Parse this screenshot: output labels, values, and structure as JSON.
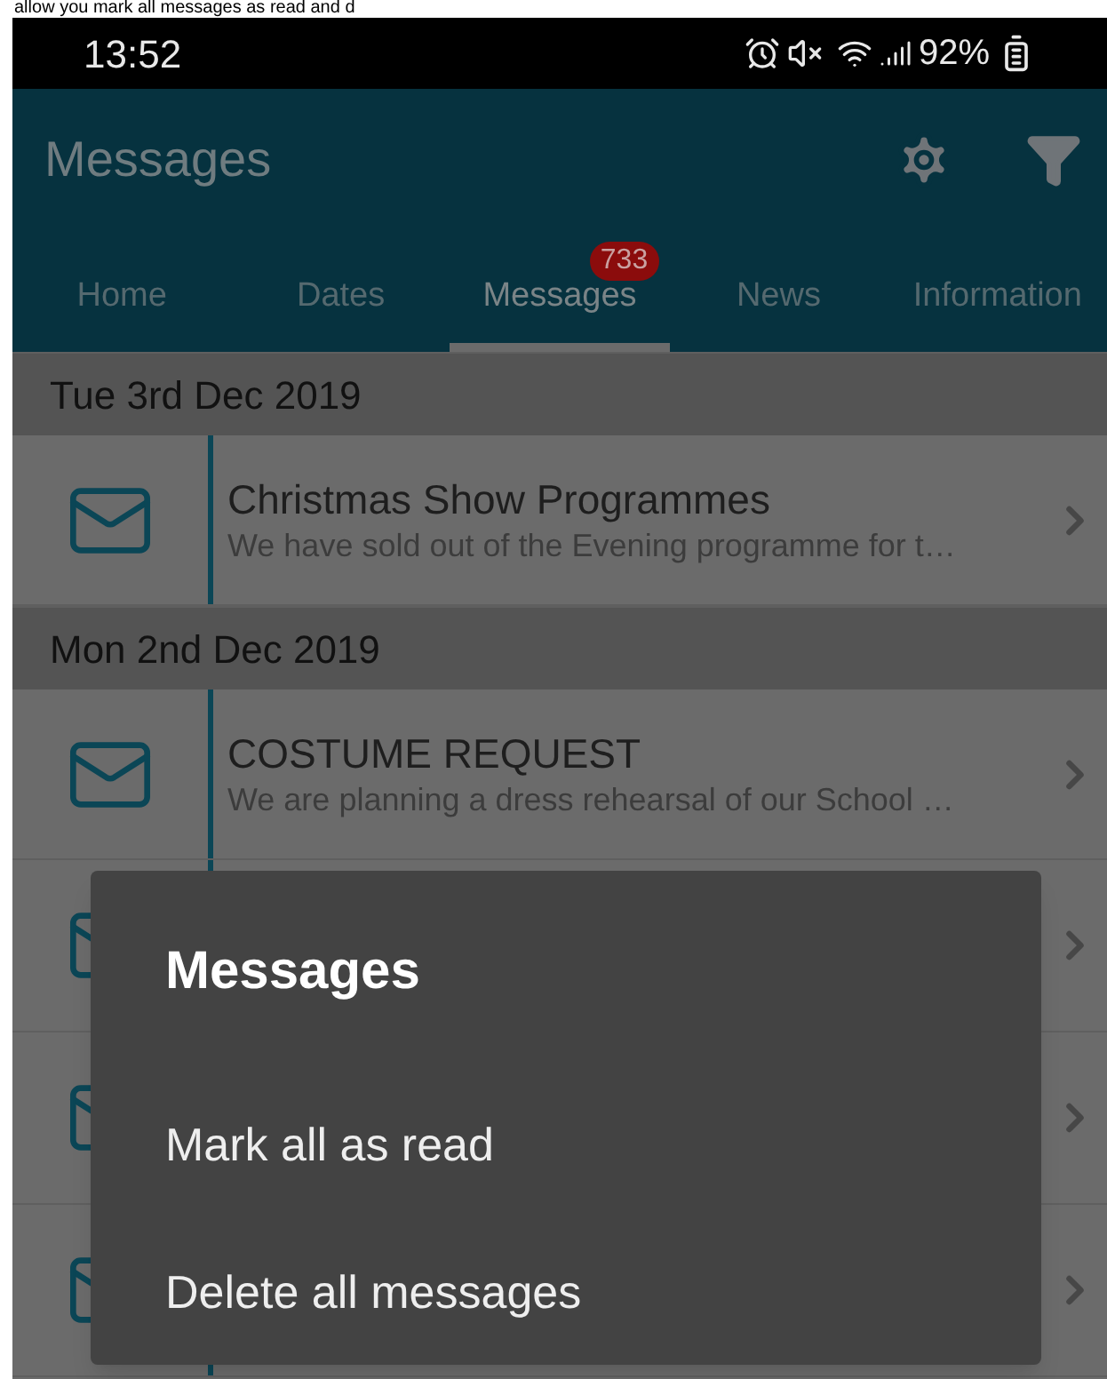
{
  "caption": "allow you mark all messages as read and d",
  "status_bar": {
    "time": "13:52",
    "battery": "92%"
  },
  "app_bar": {
    "title": "Messages"
  },
  "tabs": [
    {
      "label": "Home",
      "selected": false
    },
    {
      "label": "Dates",
      "selected": false
    },
    {
      "label": "Messages",
      "selected": true,
      "badge": "733"
    },
    {
      "label": "News",
      "selected": false
    },
    {
      "label": "Information",
      "selected": false
    }
  ],
  "sections": [
    {
      "date": "Tue 3rd Dec 2019",
      "messages": [
        {
          "kind": "message",
          "title": "Christmas Show Programmes",
          "preview": "We have sold out of the Evening programme for t…"
        }
      ]
    },
    {
      "date": "Mon 2nd Dec 2019",
      "messages": [
        {
          "kind": "message",
          "title": "COSTUME REQUEST",
          "preview": "We are planning a dress rehearsal of our School …"
        },
        {
          "kind": "covered"
        },
        {
          "kind": "covered"
        },
        {
          "kind": "covered"
        }
      ]
    }
  ],
  "dialog": {
    "title": "Messages",
    "options": [
      "Mark all as read",
      "Delete all messages"
    ]
  }
}
